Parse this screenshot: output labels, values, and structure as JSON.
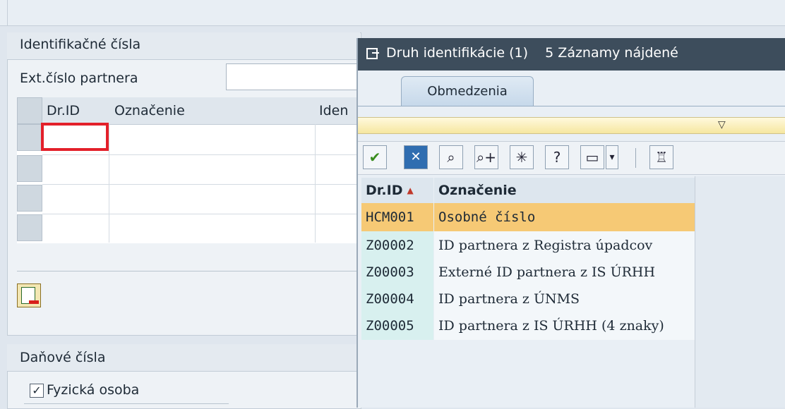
{
  "left_panel": {
    "identification_group_title": "Identifikačné čísla",
    "ext_partner_label": "Ext.číslo partnera",
    "ext_partner_value": "",
    "table_headers": [
      "Dr.ID",
      "Označenie",
      "Iden"
    ],
    "tax_group_title": "Daňové čísla",
    "natural_person_label": "Fyzická osoba",
    "natural_person_checked": true
  },
  "popup": {
    "title": "Druh identifikácie (1)    5 Záznamy nájdené",
    "tab_label": "Obmedzenia",
    "columns": [
      "Dr.ID",
      "Označenie"
    ],
    "rows": [
      {
        "id": "HCM001",
        "label": "Osobné číslo",
        "selected": true
      },
      {
        "id": "Z00002",
        "label": "ID partnera z Registra úpadcov",
        "selected": false
      },
      {
        "id": "Z00003",
        "label": "Externé ID partnera z IS ÚRHH",
        "selected": false
      },
      {
        "id": "Z00004",
        "label": "ID partnera z ÚNMS",
        "selected": false
      },
      {
        "id": "Z00005",
        "label": "ID partnera z IS ÚRHH (4 znaky)",
        "selected": false
      }
    ],
    "toolbar_icons": [
      "check-icon",
      "cancel-icon",
      "find-icon",
      "find-next-icon",
      "new-entry-icon",
      "help-icon",
      "print-icon",
      "dropdown-icon",
      "filter-icon"
    ]
  },
  "colors": {
    "highlight": "#e3202a",
    "selected_row": "#f6c975",
    "title_bar": "#3d4d5c"
  }
}
